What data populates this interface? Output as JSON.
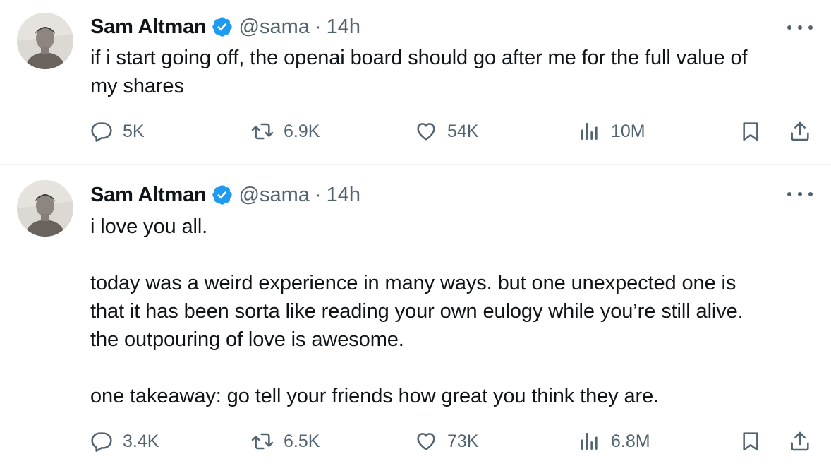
{
  "colors": {
    "text": "#0f1419",
    "muted": "#536471",
    "verified": "#1d9bf0",
    "divider": "#eff3f4"
  },
  "icons": {
    "verified": "verified-badge-icon",
    "more": "more-icon",
    "reply": "reply-icon",
    "retweet": "retweet-icon",
    "like": "heart-icon",
    "views": "views-icon",
    "bookmark": "bookmark-icon",
    "share": "share-icon"
  },
  "tweets": [
    {
      "name": "Sam Altman",
      "handle": "@sama",
      "separator": "·",
      "time": "14h",
      "text": "if i start going off, the openai board should go after me for the full value of\nmy shares",
      "replies": "5K",
      "retweets": "6.9K",
      "likes": "54K",
      "views": "10M"
    },
    {
      "name": "Sam Altman",
      "handle": "@sama",
      "separator": "·",
      "time": "14h",
      "text": "i love you all.\n\ntoday was a weird experience in many ways. but one unexpected one is\nthat it has been sorta like reading your own eulogy while you’re still alive.\nthe outpouring of love is awesome.\n\none takeaway: go tell your friends how great you think they are.",
      "replies": "3.4K",
      "retweets": "6.5K",
      "likes": "73K",
      "views": "6.8M"
    }
  ]
}
